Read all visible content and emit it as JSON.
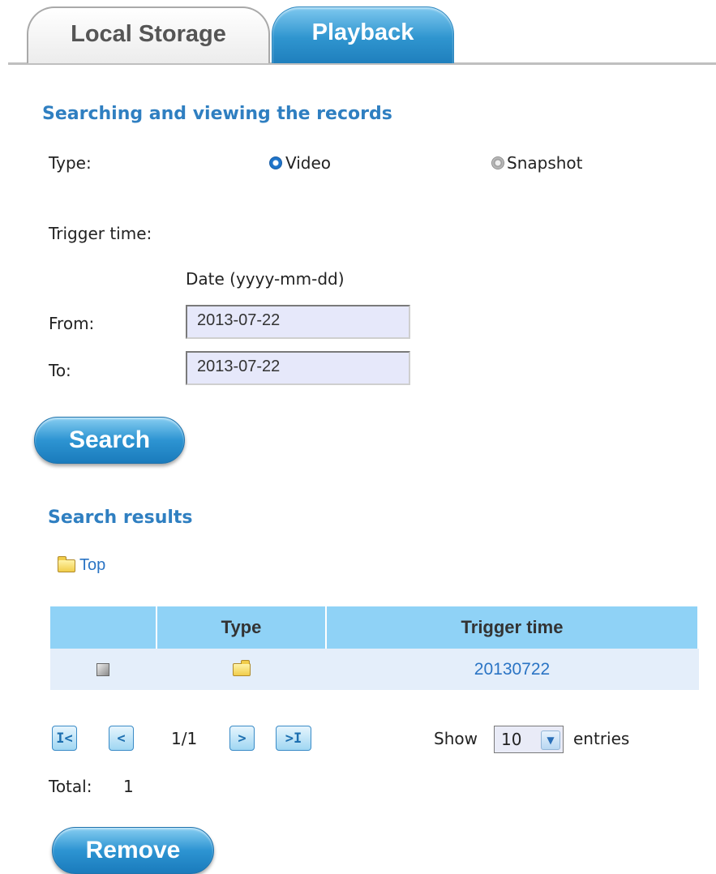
{
  "tabs": {
    "local_storage": "Local Storage",
    "playback": "Playback"
  },
  "search_section": {
    "title": "Searching and viewing the records",
    "type_label": "Type:",
    "type_options": {
      "video": "Video",
      "snapshot": "Snapshot"
    },
    "selected_type": "Video",
    "trigger_time_label": "Trigger time:",
    "date_format_label": "Date (yyyy-mm-dd)",
    "from_label": "From:",
    "from_value": "2013-07-22",
    "to_label": "To:",
    "to_value": "2013-07-22",
    "search_button": "Search"
  },
  "results": {
    "title": "Search results",
    "breadcrumb_top": "Top",
    "columns": {
      "select": "",
      "type": "Type",
      "trigger_time": "Trigger time"
    },
    "rows": [
      {
        "type_icon": "folder-icon",
        "trigger_time": "20130722"
      }
    ],
    "pagination": {
      "first": "I<",
      "prev": "<",
      "page": "1/1",
      "next": ">",
      "last": ">I"
    },
    "show_label": "Show",
    "entries_value": "10",
    "entries_label": "entries",
    "total_label": "Total:",
    "total_value": "1",
    "remove_button": "Remove"
  },
  "colors": {
    "accent": "#2f7fc1",
    "header_bg": "#8fd2f6",
    "row_bg": "#e4eefa",
    "button": "#2d94d2"
  }
}
